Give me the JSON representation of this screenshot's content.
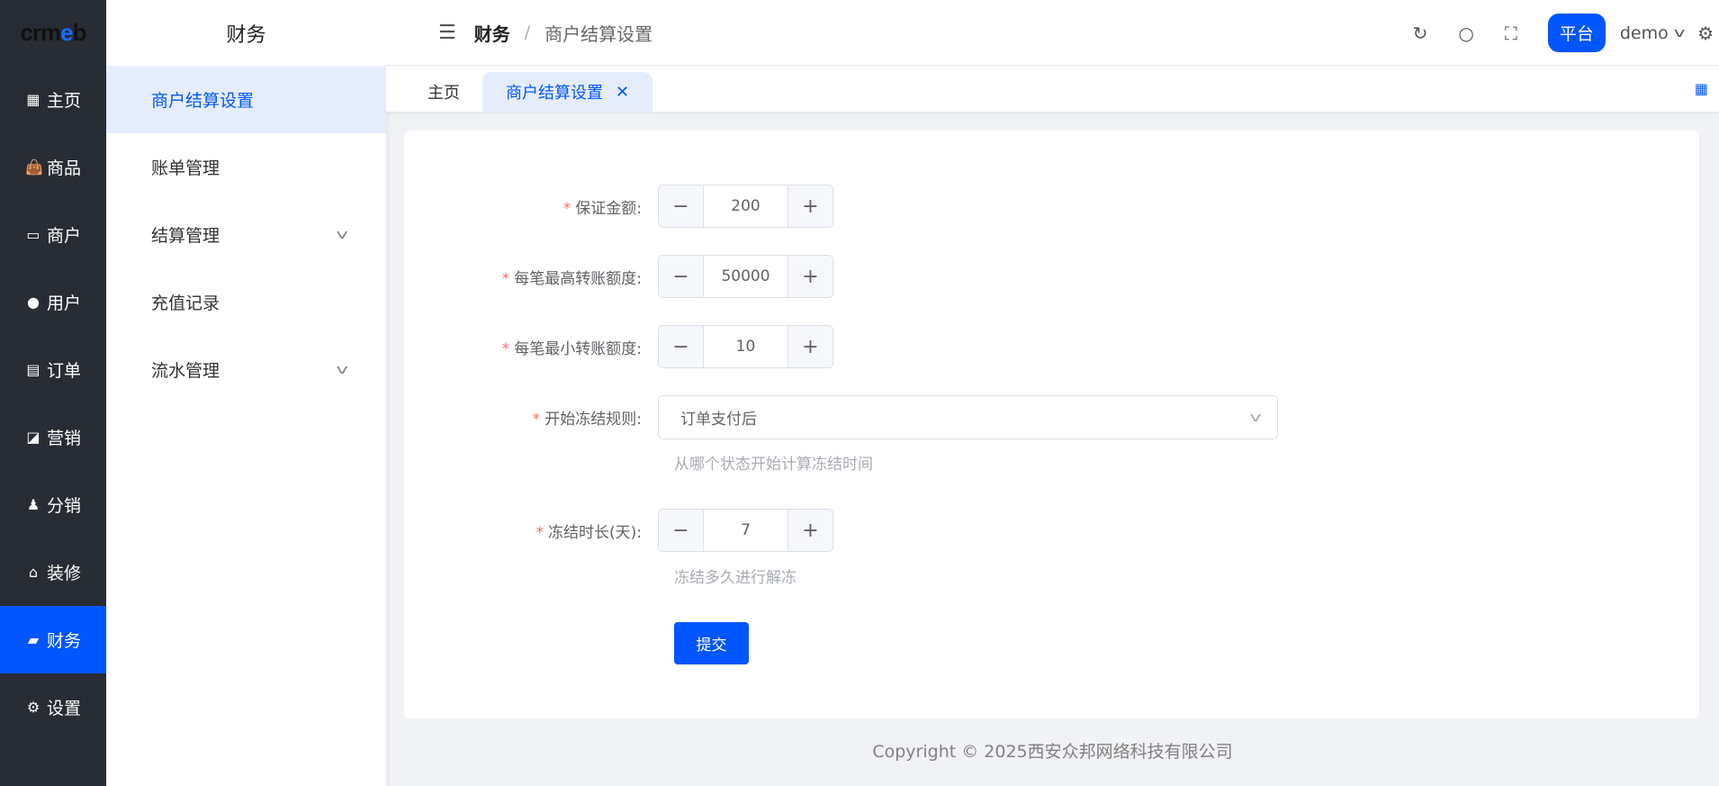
{
  "logo": "crmeb",
  "sidebar": {
    "items": [
      {
        "label": "主页",
        "icon": "grid-icon"
      },
      {
        "label": "商品",
        "icon": "bag-icon"
      },
      {
        "label": "商户",
        "icon": "store-icon"
      },
      {
        "label": "用户",
        "icon": "user-icon"
      },
      {
        "label": "订单",
        "icon": "clipboard-icon"
      },
      {
        "label": "营销",
        "icon": "chart-icon"
      },
      {
        "label": "分销",
        "icon": "share-icon"
      },
      {
        "label": "装修",
        "icon": "home-icon"
      },
      {
        "label": "财务",
        "icon": "wallet-icon"
      },
      {
        "label": "设置",
        "icon": "gear-icon"
      }
    ]
  },
  "submenu": {
    "title": "财务",
    "items": [
      {
        "label": "商户结算设置"
      },
      {
        "label": "账单管理"
      },
      {
        "label": "结算管理"
      },
      {
        "label": "充值记录"
      },
      {
        "label": "流水管理"
      }
    ]
  },
  "header": {
    "breadcrumb": [
      "财务",
      "商户结算设置"
    ],
    "separator": "/",
    "platform": "平台",
    "user": "demo"
  },
  "tabs": [
    {
      "label": "主页"
    },
    {
      "label": "商户结算设置"
    }
  ],
  "form": {
    "deposit": {
      "label": "保证金额:",
      "value": "200"
    },
    "max_transfer": {
      "label": "每笔最高转账额度:",
      "value": "50000"
    },
    "min_transfer": {
      "label": "每笔最小转账额度:",
      "value": "10"
    },
    "freeze_rule": {
      "label": "开始冻结规则:",
      "value": "订单支付后",
      "hint": "从哪个状态开始计算冻结时间"
    },
    "freeze_days": {
      "label": "冻结时长(天):",
      "value": "7",
      "hint": "冻结多久进行解冻"
    },
    "submit": "提交"
  },
  "footer": "Copyright © 2025西安众邦网络科技有限公司"
}
